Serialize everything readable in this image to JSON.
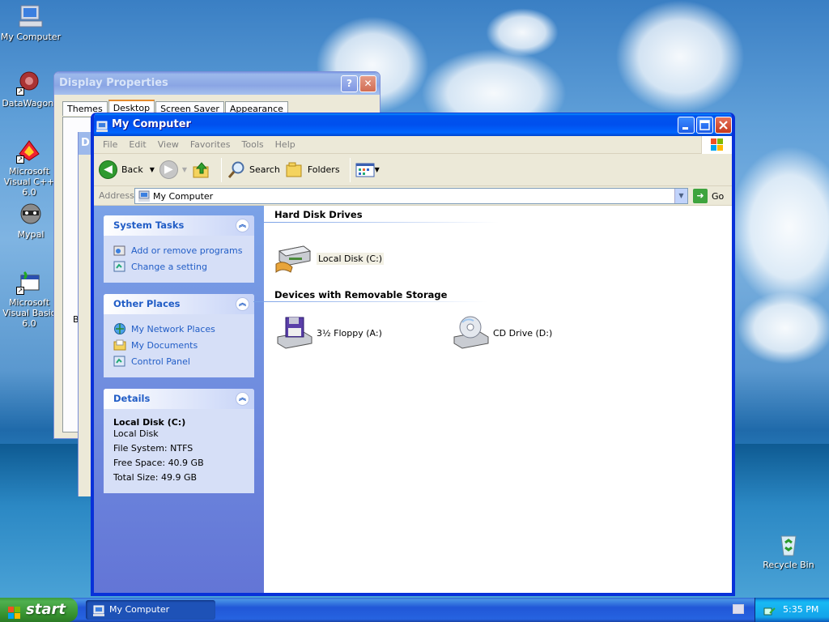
{
  "desktop": {
    "icons": [
      {
        "label": "My Computer"
      },
      {
        "label": "DataWagon."
      },
      {
        "label": "Microsoft Visual C++ 6.0"
      },
      {
        "label": "Mypal"
      },
      {
        "label": "Microsoft Visual Basic 6.0"
      },
      {
        "label": "Recycle Bin"
      }
    ]
  },
  "display_properties": {
    "title": "Display Properties",
    "help_btn": "?",
    "close_btn": "✕",
    "tabs": [
      "Themes",
      "Desktop",
      "Screen Saver",
      "Appearance"
    ],
    "active_tab": "Desktop",
    "behind_title_letter": "D",
    "fragment_b": "B"
  },
  "my_computer": {
    "title": "My Computer",
    "menu": [
      "File",
      "Edit",
      "View",
      "Favorites",
      "Tools",
      "Help"
    ],
    "toolbar": {
      "back": "Back",
      "search": "Search",
      "folders": "Folders"
    },
    "address": {
      "label": "Address",
      "value": "My Computer",
      "go": "Go"
    },
    "task_pane": {
      "system_tasks": {
        "title": "System Tasks",
        "items": [
          "Add or remove programs",
          "Change a setting"
        ]
      },
      "other_places": {
        "title": "Other Places",
        "items": [
          "My Network Places",
          "My Documents",
          "Control Panel"
        ]
      },
      "details": {
        "title": "Details",
        "name": "Local Disk (C:)",
        "type": "Local Disk",
        "file_system": "File System: NTFS",
        "free_space": "Free Space: 40.9 GB",
        "total_size": "Total Size: 49.9 GB"
      }
    },
    "groups": {
      "hard_disks": {
        "title": "Hard Disk Drives",
        "items": [
          "Local Disk (C:)"
        ]
      },
      "removable": {
        "title": "Devices with Removable Storage",
        "items": [
          "3½ Floppy (A:)",
          "CD Drive (D:)"
        ]
      }
    }
  },
  "taskbar": {
    "start": "start",
    "task_item": "My Computer",
    "clock": "5:35 PM"
  },
  "colors": {
    "title_active": "#0050ee",
    "task_link": "#215dc6",
    "start_green": "#36912f"
  }
}
